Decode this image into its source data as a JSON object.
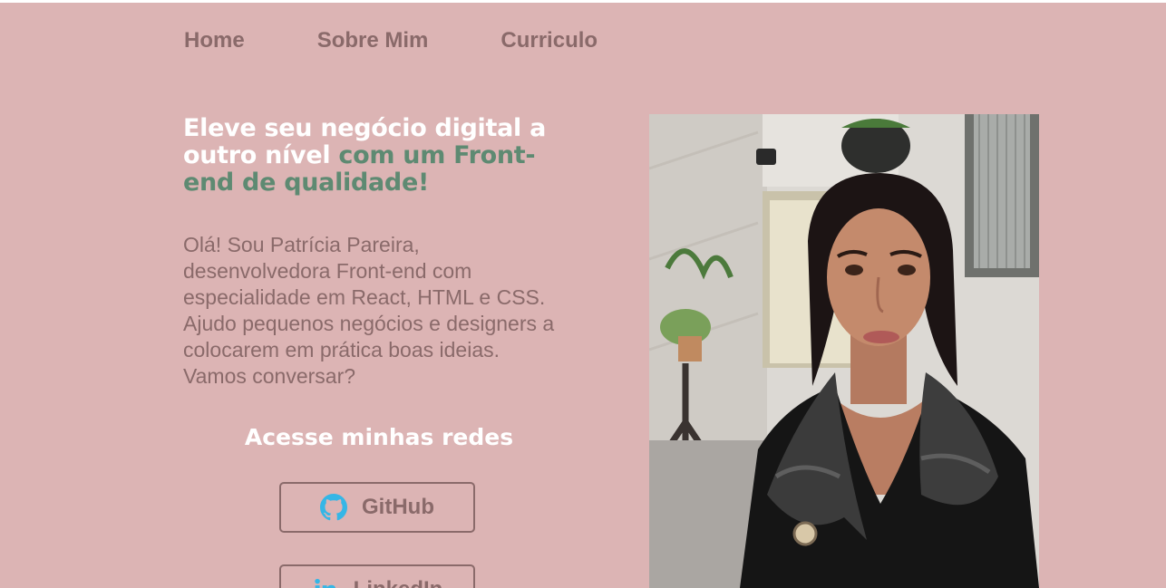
{
  "nav": {
    "items": [
      {
        "label": "Home"
      },
      {
        "label": "Sobre Mim"
      },
      {
        "label": "Curriculo"
      }
    ]
  },
  "hero": {
    "headline_white": "Eleve seu negócio digital a outro nível",
    "headline_green": "com um Front-end de qualidade!",
    "intro": "Olá! Sou Patrícia Pareira, desenvolvedora Front-end com especialidade em React, HTML e CSS. Ajudo pequenos negócios e designers a colocarem em prática boas ideias. Vamos conversar?"
  },
  "networks": {
    "title": "Acesse minhas redes",
    "github_label": "GitHub",
    "linkedin_label": "LinkedIn"
  },
  "colors": {
    "background": "#dcb4b4",
    "text_muted": "#8a6a6a",
    "accent_green": "#5e8a72",
    "icon_blue": "#35b6e6"
  },
  "icons": {
    "github": "github-icon",
    "linkedin": "linkedin-icon"
  }
}
